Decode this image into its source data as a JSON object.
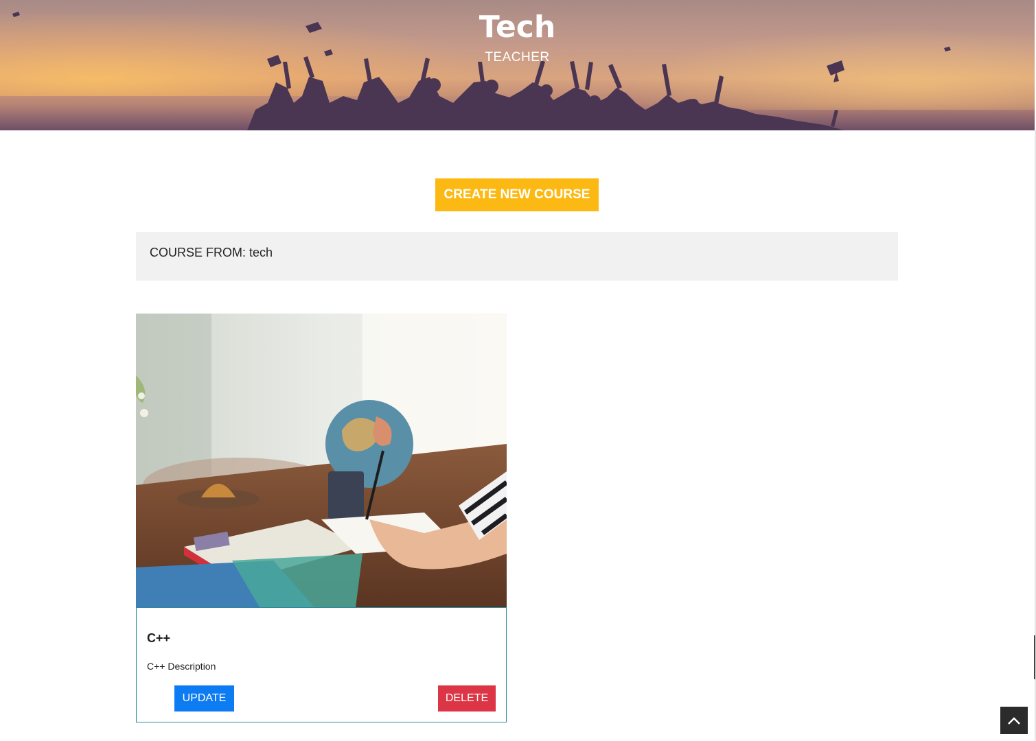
{
  "hero": {
    "title": "Tech",
    "subtitle": "TEACHER"
  },
  "actions": {
    "create_label": "CREATE NEW COURSE"
  },
  "course_from": {
    "label": "COURSE FROM: tech"
  },
  "courses": [
    {
      "title": "C++",
      "description": "C++ Description",
      "update_label": "UPDATE",
      "delete_label": "DELETE"
    }
  ],
  "colors": {
    "accent": "#fdb913",
    "update": "#0d7bf2",
    "delete": "#dc3545",
    "card_border": "#2a8a9e"
  },
  "icons": {
    "scroll_top": "chevron-up-icon"
  }
}
